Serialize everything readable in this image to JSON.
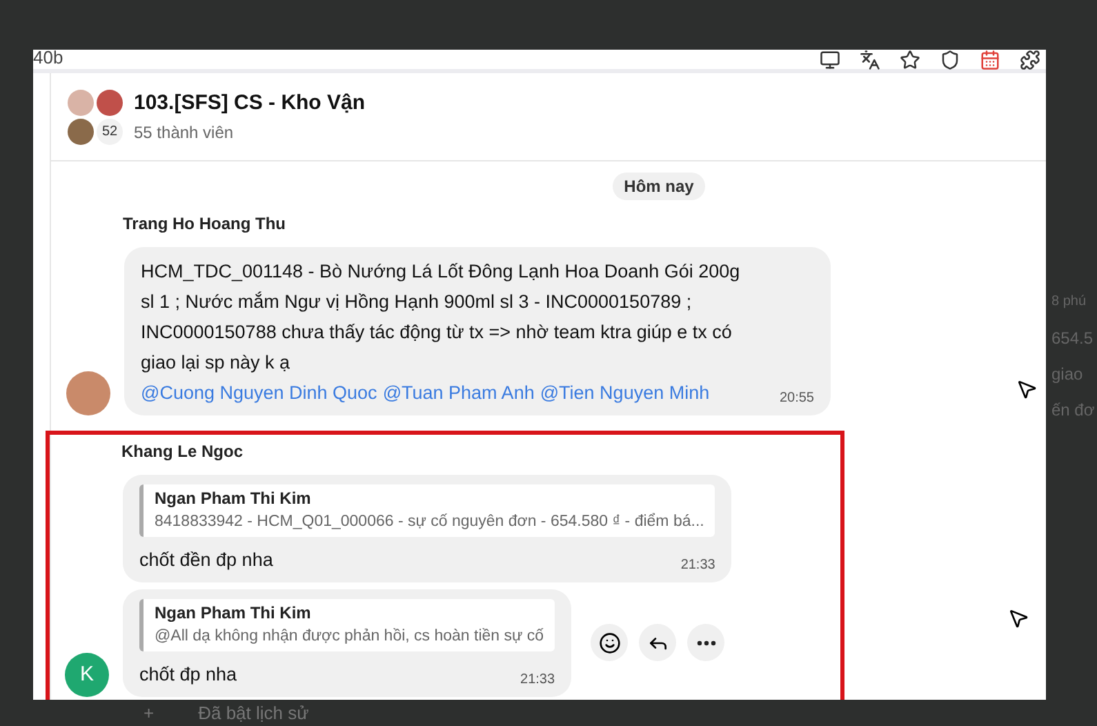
{
  "browser_bar": {
    "url_fragment": "40b"
  },
  "chat": {
    "title": "103.[SFS] CS - Kho Vận",
    "members": "55 thành viên",
    "avatar_count": "52",
    "date_separator": "Hôm nay",
    "groups": [
      {
        "sender": "Trang Ho Hoang Thu",
        "avatar": {
          "kind": "photo"
        },
        "highlighted": false,
        "messages": [
          {
            "parts": [
              {
                "kind": "text",
                "text": "HCM_TDC_001148 - Bò Nướng Lá Lốt Đông Lạnh Hoa Doanh Gói 200g sl 1 ; Nước mắm Ngư vị Hồng Hạnh 900ml sl 3 - INC0000150789 ; INC0000150788 chưa thấy tác động từ tx => nhờ team ktra giúp e tx có giao lại sp này k ạ "
              },
              {
                "kind": "mention",
                "text": "@Cuong Nguyen Dinh Quoc"
              },
              {
                "kind": "mention",
                "text": "@Tuan Pham Anh"
              },
              {
                "kind": "mention",
                "text": "@Tien Nguyen Minh"
              }
            ],
            "time": "20:55",
            "show_actions": false
          }
        ]
      },
      {
        "sender": "Khang Le Ngoc",
        "avatar": {
          "kind": "letter",
          "letter": "K",
          "color": "#1fa870"
        },
        "highlighted": true,
        "messages": [
          {
            "quote": {
              "author": "Ngan Pham Thi Kim",
              "text": "8418833942 - HCM_Q01_000066 - sự cố nguyên đơn - 654.580 ₫ - điểm bá..."
            },
            "parts": [
              {
                "kind": "text",
                "text": "chốt đền đp nha"
              }
            ],
            "time": "21:33",
            "show_actions": false
          },
          {
            "quote": {
              "author": "Ngan Pham Thi Kim",
              "text": "@All dạ không nhận được phản hồi, cs hoàn tiền sự cố"
            },
            "parts": [
              {
                "kind": "text",
                "text": "chốt đp nha"
              }
            ],
            "time": "21:33",
            "show_actions": true
          }
        ]
      }
    ]
  },
  "background": {
    "side_texts": [
      "8 phú",
      "654.5",
      "giao",
      "ến đơ"
    ],
    "composer_add": "+",
    "composer_text": "Đã bật lịch sử"
  }
}
